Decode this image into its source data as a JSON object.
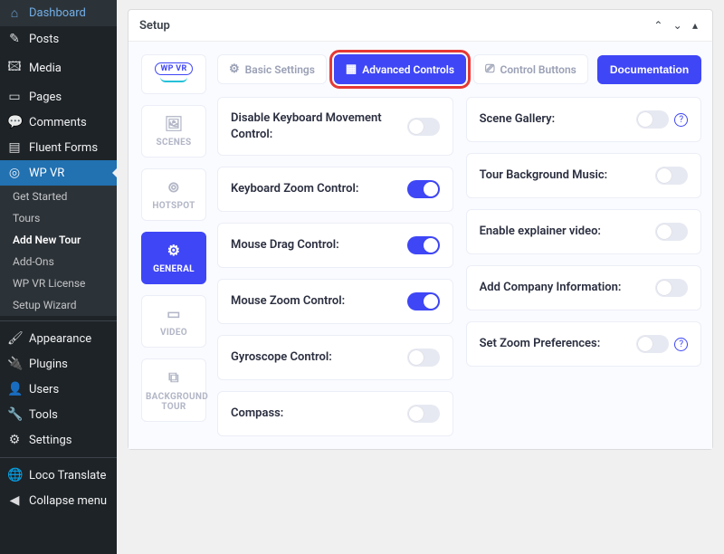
{
  "wp_menu": {
    "items": [
      {
        "icon": "⌂",
        "label": "Dashboard"
      },
      {
        "icon": "✎",
        "label": "Posts"
      },
      {
        "icon": "🖾",
        "label": "Media"
      },
      {
        "icon": "▭",
        "label": "Pages"
      },
      {
        "icon": "💬",
        "label": "Comments"
      },
      {
        "icon": "▤",
        "label": "Fluent Forms"
      }
    ],
    "wpvr": {
      "icon": "◎",
      "label": "WP VR"
    },
    "wpvr_subs": [
      {
        "label": "Get Started"
      },
      {
        "label": "Tours"
      },
      {
        "label": "Add New Tour",
        "current": true
      },
      {
        "label": "Add-Ons"
      },
      {
        "label": "WP VR License"
      },
      {
        "label": "Setup Wizard"
      }
    ],
    "bottom": [
      {
        "icon": "🖌",
        "label": "Appearance"
      },
      {
        "icon": "🔌",
        "label": "Plugins"
      },
      {
        "icon": "👤",
        "label": "Users"
      },
      {
        "icon": "🔧",
        "label": "Tools"
      },
      {
        "icon": "⚙",
        "label": "Settings"
      }
    ],
    "extra": [
      {
        "icon": "🌐",
        "label": "Loco Translate"
      },
      {
        "icon": "◀",
        "label": "Collapse menu"
      }
    ]
  },
  "panel": {
    "title": "Setup"
  },
  "vtabs": [
    {
      "key": "logo",
      "label": "WP VR"
    },
    {
      "key": "scenes",
      "icon": "🖼",
      "label": "SCENES"
    },
    {
      "key": "hotspot",
      "icon": "⊚",
      "label": "HOTSPOT"
    },
    {
      "key": "general",
      "icon": "⚙",
      "label": "GENERAL",
      "active": true
    },
    {
      "key": "video",
      "icon": "▭",
      "label": "VIDEO"
    },
    {
      "key": "bgtour",
      "icon": "⧉",
      "label": "BACKGROUND TOUR"
    }
  ],
  "htabs": [
    {
      "icon": "⚙",
      "label": "Basic Settings"
    },
    {
      "icon": "▦",
      "label": "Advanced Controls",
      "active": true
    },
    {
      "icon": "⎚",
      "label": "Control Buttons"
    }
  ],
  "documentation": "Documentation",
  "left_settings": [
    {
      "label": "Disable Keyboard Movement Control:",
      "on": false
    },
    {
      "label": "Keyboard Zoom Control:",
      "on": true
    },
    {
      "label": "Mouse Drag Control:",
      "on": true
    },
    {
      "label": "Mouse Zoom Control:",
      "on": true
    },
    {
      "label": "Gyroscope Control:",
      "on": false
    },
    {
      "label": "Compass:",
      "on": false
    }
  ],
  "right_settings": [
    {
      "label": "Scene Gallery:",
      "on": false,
      "info": true
    },
    {
      "label": "Tour Background Music:",
      "on": false
    },
    {
      "label": "Enable explainer video:",
      "on": false
    },
    {
      "label": "Add Company Information:",
      "on": false
    },
    {
      "label": "Set Zoom Preferences:",
      "on": false,
      "info": true
    }
  ]
}
